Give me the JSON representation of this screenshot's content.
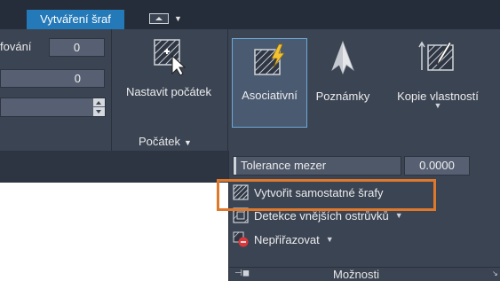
{
  "tabs": {
    "active_label": "Vytváření šraf"
  },
  "left_panel": {
    "label_partial": "fování",
    "field1_value": "0",
    "field2_value": "0"
  },
  "origin_group": {
    "set_origin_label": "Nastavit počátek",
    "title": "Počátek"
  },
  "options_buttons": {
    "associative_label": "Asociativní",
    "annotative_label": "Poznámky",
    "match_properties_label": "Kopie vlastností"
  },
  "options_panel": {
    "gap_tolerance_label": "Tolerance mezer",
    "gap_tolerance_value": "0.0000",
    "separate_hatches_label": "Vytvořit samostatné šrafy",
    "island_detection_label": "Detekce vnějších ostrůvků",
    "draw_order_label": "Nepřiřazovat",
    "title": "Možnosti"
  },
  "colors": {
    "ribbon_bg": "#3b4453",
    "tab_active": "#2479b8",
    "highlight": "#e0782c"
  }
}
